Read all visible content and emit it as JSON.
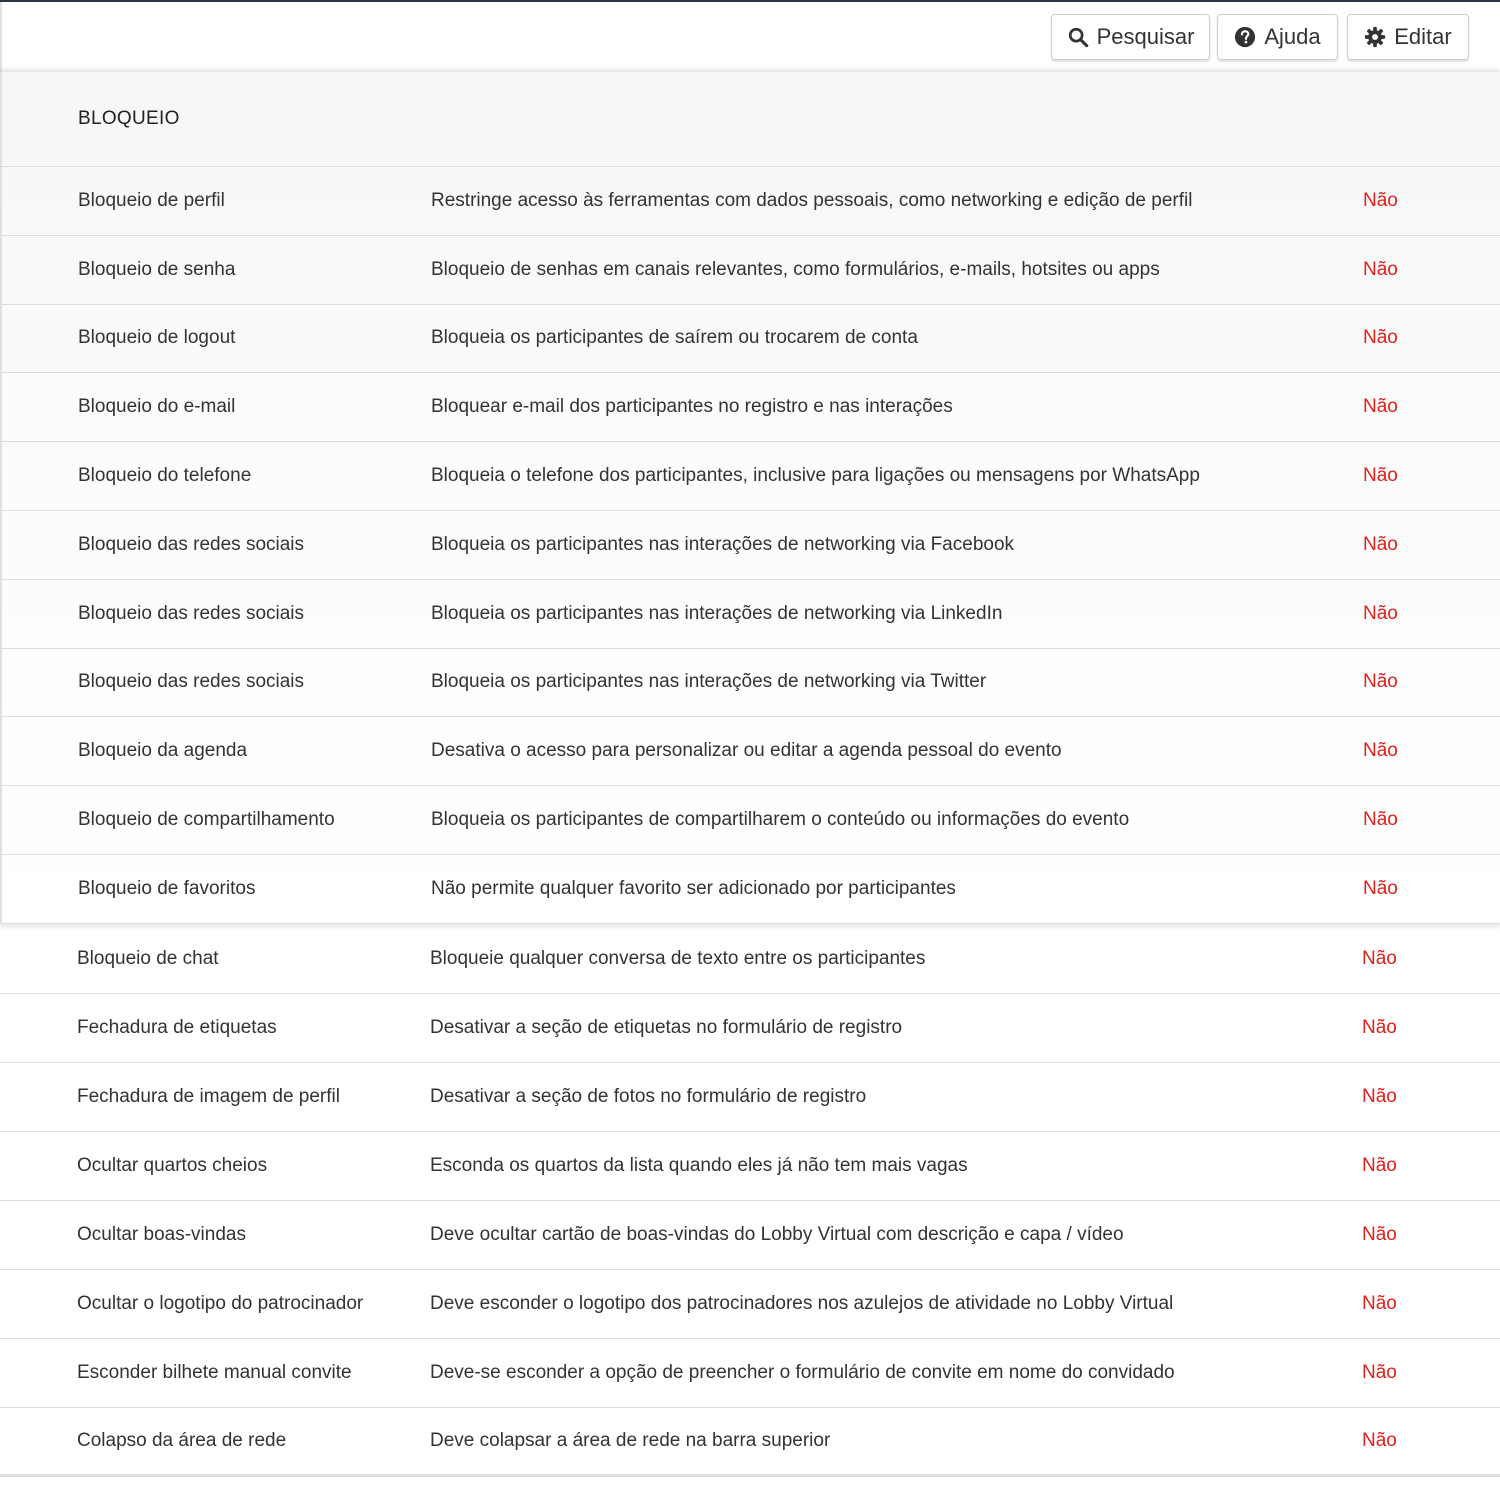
{
  "toolbar": {
    "search_label": "Pesquisar",
    "help_label": "Ajuda",
    "edit_label": "Editar"
  },
  "section": {
    "title": "BLOQUEIO"
  },
  "rows": [
    {
      "name": "Bloqueio de perfil",
      "description": "Restringe acesso às ferramentas com dados pessoais, como networking e edição de perfil",
      "value": "Não"
    },
    {
      "name": "Bloqueio de senha",
      "description": "Bloqueio de senhas em canais relevantes, como formulários, e-mails, hotsites ou apps",
      "value": "Não"
    },
    {
      "name": "Bloqueio de logout",
      "description": "Bloqueia os participantes de saírem ou trocarem de conta",
      "value": "Não"
    },
    {
      "name": "Bloqueio do e-mail",
      "description": "Bloquear e-mail dos participantes no registro e nas interações",
      "value": "Não"
    },
    {
      "name": "Bloqueio do telefone",
      "description": "Bloqueia o telefone dos participantes, inclusive para ligações ou mensagens por WhatsApp",
      "value": "Não"
    },
    {
      "name": "Bloqueio das redes sociais",
      "description": "Bloqueia os participantes nas interações de networking via Facebook",
      "value": "Não"
    },
    {
      "name": "Bloqueio das redes sociais",
      "description": "Bloqueia os participantes nas interações de networking via LinkedIn",
      "value": "Não"
    },
    {
      "name": "Bloqueio das redes sociais",
      "description": "Bloqueia os participantes nas interações de networking via Twitter",
      "value": "Não"
    },
    {
      "name": "Bloqueio da agenda",
      "description": "Desativa o acesso para personalizar ou editar a agenda pessoal do evento",
      "value": "Não"
    },
    {
      "name": "Bloqueio de compartilhamento",
      "description": "Bloqueia os participantes de compartilharem o conteúdo ou informações do evento",
      "value": "Não"
    },
    {
      "name": "Bloqueio de favoritos",
      "description": "Não permite qualquer favorito ser adicionado por participantes",
      "value": "Não"
    }
  ],
  "tail_rows": [
    {
      "name": "Bloqueio de chat",
      "description": "Bloqueie qualquer conversa de texto entre os participantes",
      "value": "Não"
    },
    {
      "name": "Fechadura de etiquetas",
      "description": "Desativar a seção de etiquetas no formulário de registro",
      "value": "Não"
    },
    {
      "name": "Fechadura de imagem de perfil",
      "description": "Desativar a seção de fotos no formulário de registro",
      "value": "Não"
    },
    {
      "name": "Ocultar quartos cheios",
      "description": "Esconda os quartos da lista quando eles já não tem mais vagas",
      "value": "Não"
    },
    {
      "name": "Ocultar boas-vindas",
      "description": "Deve ocultar cartão de boas-vindas do Lobby Virtual com descrição e capa / vídeo",
      "value": "Não"
    },
    {
      "name": "Ocultar o logotipo do patrocinador",
      "description": "Deve esconder o logotipo dos patrocinadores nos azulejos de atividade no Lobby Virtual",
      "value": "Não"
    },
    {
      "name": "Esconder bilhete manual convite",
      "description": "Deve-se esconder a opção de preencher o formulário de convite em nome do convidado",
      "value": "Não"
    },
    {
      "name": "Colapso da área de rede",
      "description": "Deve colapsar a área de rede na barra superior",
      "value": "Não"
    }
  ],
  "icons": {
    "search": "search-icon",
    "help": "help-circle-icon",
    "edit": "gear-icon"
  },
  "colors": {
    "value_no": "#e0201b",
    "topline": "#2b3547"
  }
}
